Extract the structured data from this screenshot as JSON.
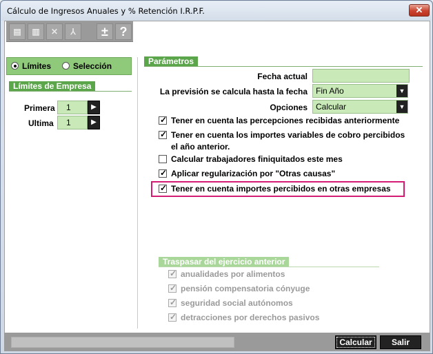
{
  "window": {
    "title": "Cálculo de Ingresos Anuales y % Retención I.R.P.F.",
    "close_glyph": "✕"
  },
  "toolbar": {
    "buttons": [
      {
        "icon": "print-icon",
        "glyph": "▤"
      },
      {
        "icon": "preview-icon",
        "glyph": "▥"
      },
      {
        "icon": "excel-icon",
        "glyph": "✕"
      },
      {
        "icon": "pdf-icon",
        "glyph": "⅄"
      },
      {
        "icon": "plus-minus-icon",
        "glyph": "±"
      },
      {
        "icon": "help-icon",
        "glyph": "?"
      }
    ]
  },
  "mode": {
    "options": [
      {
        "label": "Límites",
        "checked": true
      },
      {
        "label": "Selección",
        "checked": false
      }
    ]
  },
  "limites_empresa": {
    "title": "Límites de Empresa",
    "primera_label": "Primera",
    "primera_value": "1",
    "ultima_label": "Ultima",
    "ultima_value": "1",
    "spin_glyph": "▶"
  },
  "parametros": {
    "title": "Parámetros",
    "fecha_actual_label": "Fecha actual",
    "fecha_actual_value": "",
    "prevision_label": "La previsión se calcula hasta la fecha",
    "prevision_value": "Fin Año",
    "opciones_label": "Opciones",
    "opciones_value": "Calcular",
    "arrow_glyph": "▼",
    "checks": [
      {
        "label": "Tener en cuenta las percepciones recibidas anteriormente",
        "checked": true
      },
      {
        "label": "Tener en cuenta los importes variables de cobro percibidos",
        "label2": "el año anterior.",
        "checked": true
      },
      {
        "label": "Calcular trabajadores finiquitados este mes",
        "checked": false
      },
      {
        "label": "Aplicar regularización por \"Otras causas\"",
        "checked": true
      },
      {
        "label": "Tener en cuenta importes percibidos en otras empresas",
        "checked": true
      }
    ]
  },
  "traspasar": {
    "title": "Traspasar del ejercicio anterior",
    "items": [
      {
        "label": "anualidades por alimentos",
        "checked": true
      },
      {
        "label": "pensión compensatoria cónyuge",
        "checked": true
      },
      {
        "label": "seguridad social autónomos",
        "checked": true
      },
      {
        "label": "detracciones por derechos pasivos",
        "checked": true
      }
    ]
  },
  "footer": {
    "calcular_label": "Calcular",
    "salir_label": "Salir"
  }
}
